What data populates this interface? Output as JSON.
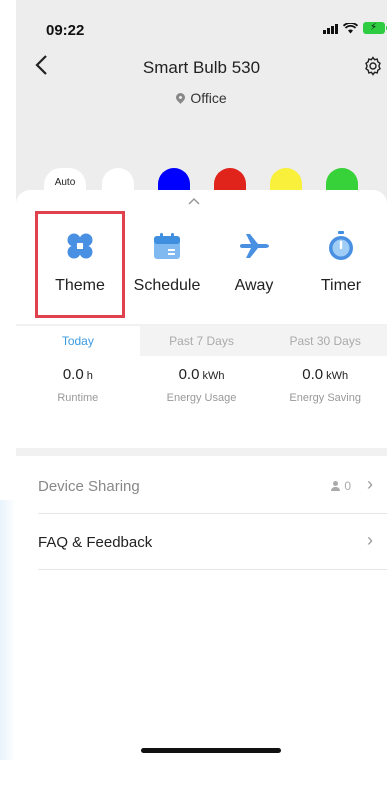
{
  "status_bar": {
    "time": "09:22"
  },
  "header": {
    "title": "Smart Bulb 530",
    "location": "Office"
  },
  "colors": {
    "auto_label": "Auto",
    "swatches": [
      "#ffffff",
      "#0000ff",
      "#e0241b",
      "#f8f03a",
      "#37d13a"
    ]
  },
  "features": [
    {
      "label": "Theme",
      "icon": "theme-icon"
    },
    {
      "label": "Schedule",
      "icon": "calendar-icon"
    },
    {
      "label": "Away",
      "icon": "airplane-icon"
    },
    {
      "label": "Timer",
      "icon": "timer-icon"
    }
  ],
  "tabs": [
    "Today",
    "Past 7 Days",
    "Past 30 Days"
  ],
  "active_tab": "Today",
  "stats": [
    {
      "value": "0.0",
      "unit": "h",
      "label": "Runtime"
    },
    {
      "value": "0.0",
      "unit": "kWh",
      "label": "Energy Usage"
    },
    {
      "value": "0.0",
      "unit": "kWh",
      "label": "Energy Saving"
    }
  ],
  "list": {
    "device_sharing": {
      "label": "Device Sharing",
      "count": "0"
    },
    "faq": {
      "label": "FAQ & Feedback"
    }
  },
  "theme": {
    "accent": "#3c9be3",
    "highlight": "#e0414f"
  }
}
